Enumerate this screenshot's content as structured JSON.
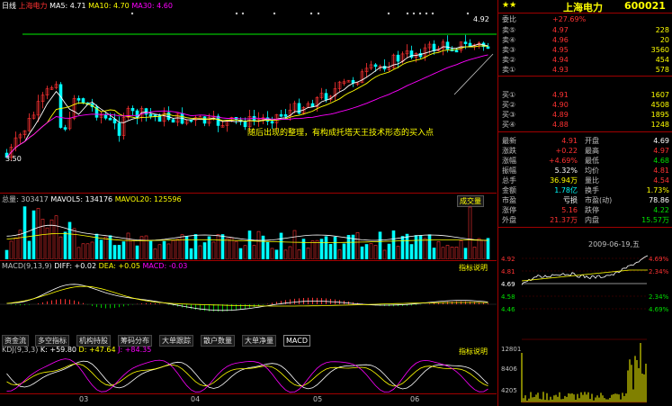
{
  "stock": {
    "title": "上海电力",
    "code": "600021",
    "stars": "★★"
  },
  "kline": {
    "label": "日线",
    "ma_header": [
      {
        "text": "MA5: 4.71",
        "color": "#ffffff"
      },
      {
        "text": "MA10: 4.70",
        "color": "#ffff00"
      },
      {
        "text": "MA30: 4.60",
        "color": "#ff00ff"
      }
    ],
    "top_price": "4.92",
    "low_price": "3.50",
    "annotation": "随后出现的整理，有构成托塔天王技术形态的买入点"
  },
  "volume_pane": {
    "header": [
      {
        "text": "总量: 303417",
        "color": "#c0c0c0"
      },
      {
        "text": "MAVOL5: 134176",
        "color": "#ffffff"
      },
      {
        "text": "MAVOL20: 125596",
        "color": "#ffff00"
      }
    ],
    "tag": "成交量"
  },
  "macd_pane": {
    "header": [
      {
        "text": "MACD(9,13,9)",
        "color": "#c0c0c0"
      },
      {
        "text": "DIFF: +0.02",
        "color": "#ffffff"
      },
      {
        "text": "DEA: +0.05",
        "color": "#ffff00"
      },
      {
        "text": "MACD: -0.03",
        "color": "#ff00ff"
      }
    ],
    "tag": "指标说明"
  },
  "tabs": [
    "资金流",
    "多空指标",
    "机构持股",
    "筹码分布",
    "大单跟踪",
    "散户数量",
    "大单净量",
    "MACD"
  ],
  "active_tab": "MACD",
  "kdj_pane": {
    "header": [
      {
        "text": "KDJ(9,3,3)",
        "color": "#c0c0c0"
      },
      {
        "text": "K: +59.80",
        "color": "#ffffff"
      },
      {
        "text": "D: +47.64",
        "color": "#ffff00"
      },
      {
        "text": "J: +84.35",
        "color": "#ff00ff"
      }
    ],
    "tag": "指标说明"
  },
  "months": [
    "03",
    "04",
    "05",
    "06"
  ],
  "order_book": {
    "ratio": {
      "label": "委比",
      "value": "+27.69%"
    },
    "sells": [
      {
        "label": "卖⑤",
        "price": "4.97",
        "vol": "228"
      },
      {
        "label": "卖④",
        "price": "4.96",
        "vol": "20"
      },
      {
        "label": "卖③",
        "price": "4.95",
        "vol": "3560"
      },
      {
        "label": "卖②",
        "price": "4.94",
        "vol": "454"
      },
      {
        "label": "卖①",
        "price": "4.93",
        "vol": "578"
      }
    ],
    "buys": [
      {
        "label": "买①",
        "price": "4.91",
        "vol": "1607"
      },
      {
        "label": "买②",
        "price": "4.90",
        "vol": "4508"
      },
      {
        "label": "买③",
        "price": "4.89",
        "vol": "1895"
      },
      {
        "label": "买④",
        "price": "4.88",
        "vol": "1248"
      }
    ]
  },
  "quote": [
    {
      "l1": "最新",
      "v1": "4.91",
      "c1": "red",
      "l2": "开盘",
      "v2": "4.69",
      "c2": "white"
    },
    {
      "l1": "涨跌",
      "v1": "+0.22",
      "c1": "red",
      "l2": "最高",
      "v2": "4.97",
      "c2": "red"
    },
    {
      "l1": "涨幅",
      "v1": "+4.69%",
      "c1": "red",
      "l2": "最低",
      "v2": "4.68",
      "c2": "green"
    },
    {
      "l1": "振幅",
      "v1": "5.32%",
      "c1": "white",
      "l2": "均价",
      "v2": "4.81",
      "c2": "red"
    },
    {
      "l1": "总手",
      "v1": "36.94万",
      "c1": "yellow",
      "l2": "量比",
      "v2": "4.54",
      "c2": "red"
    },
    {
      "l1": "金额",
      "v1": "1.78亿",
      "c1": "cyan",
      "l2": "换手",
      "v2": "1.73%",
      "c2": "yellow"
    },
    {
      "l1": "市盈",
      "v1": "亏损",
      "c1": "white",
      "l2": "市盈(动)",
      "v2": "78.86",
      "c2": "white"
    },
    {
      "l1": "涨停",
      "v1": "5.16",
      "c1": "red",
      "l2": "跌停",
      "v2": "4.22",
      "c2": "green"
    },
    {
      "l1": "外盘",
      "v1": "21.37万",
      "c1": "red",
      "l2": "内盘",
      "v2": "15.57万",
      "c2": "green"
    }
  ],
  "intraday": {
    "date": "2009-06-19,五",
    "price_labels": [
      "4.92",
      "4.81",
      "4.69",
      "4.58",
      "4.46"
    ],
    "pct_labels": [
      "4.69%",
      "2.34%",
      "2.34%",
      "4.69%"
    ],
    "base_price": "4.69",
    "vol_labels": [
      "12801",
      "8406",
      "4205"
    ]
  }
}
